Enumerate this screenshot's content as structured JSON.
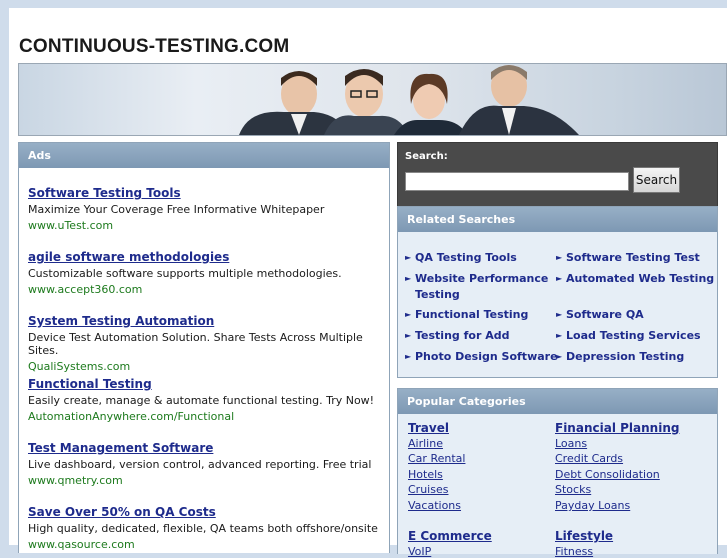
{
  "site": {
    "title": "CONTINUOUS-TESTING.COM"
  },
  "ads": {
    "heading": "Ads",
    "items": [
      {
        "title": "Software Testing Tools",
        "desc": "Maximize Your Coverage Free Informative Whitepaper",
        "url": "www.uTest.com"
      },
      {
        "title": "agile software methodologies",
        "desc": "Customizable software supports multiple methodologies.",
        "url": "www.accept360.com"
      },
      {
        "title": "System Testing Automation",
        "desc": "Device Test Automation Solution. Share Tests Across Multiple Sites.",
        "url": "QualiSystems.com"
      },
      {
        "title": "Functional Testing",
        "desc": "Easily create, manage & automate functional testing. Try Now!",
        "url": "AutomationAnywhere.com/Functional"
      },
      {
        "title": "Test Management Software",
        "desc": "Live dashboard, version control, advanced reporting. Free trial",
        "url": "www.qmetry.com"
      },
      {
        "title": "Save Over 50% on QA Costs",
        "desc": "High quality, dedicated, flexible, QA teams both offshore/onsite",
        "url": "www.qasource.com"
      }
    ]
  },
  "search": {
    "label": "Search:",
    "value": "",
    "button": "Search"
  },
  "related": {
    "heading": "Related Searches",
    "items": [
      {
        "line1": "QA Testing Tools",
        "line2": ""
      },
      {
        "line1": "Software Testing Test",
        "line2": ""
      },
      {
        "line1": "Website Performance",
        "line2": "Testing"
      },
      {
        "line1": "Automated Web Testing",
        "line2": ""
      },
      {
        "line1": "Functional Testing",
        "line2": ""
      },
      {
        "line1": "Software QA",
        "line2": ""
      },
      {
        "line1": "Testing for Add",
        "line2": ""
      },
      {
        "line1": "Load Testing Services",
        "line2": ""
      },
      {
        "line1": "Photo Design Software",
        "line2": ""
      },
      {
        "line1": "Depression Testing",
        "line2": ""
      }
    ]
  },
  "popular": {
    "heading": "Popular Categories",
    "left": {
      "title": "Travel",
      "items": [
        "Airline",
        "Car Rental",
        "Hotels",
        "Cruises",
        "Vacations"
      ]
    },
    "right": {
      "title": "Financial Planning",
      "items": [
        "Loans",
        "Credit Cards",
        "Debt Consolidation",
        "Stocks",
        "Payday Loans"
      ]
    },
    "left2": {
      "title": "E Commerce",
      "items": [
        "VoIP"
      ]
    },
    "right2": {
      "title": "Lifestyle",
      "items": [
        "Fitness"
      ]
    }
  },
  "colors": {
    "link": "#1e2b8c",
    "url": "#1d7a1d",
    "panel_header": "#7d98b3",
    "search_bg": "#4a4a4a"
  }
}
